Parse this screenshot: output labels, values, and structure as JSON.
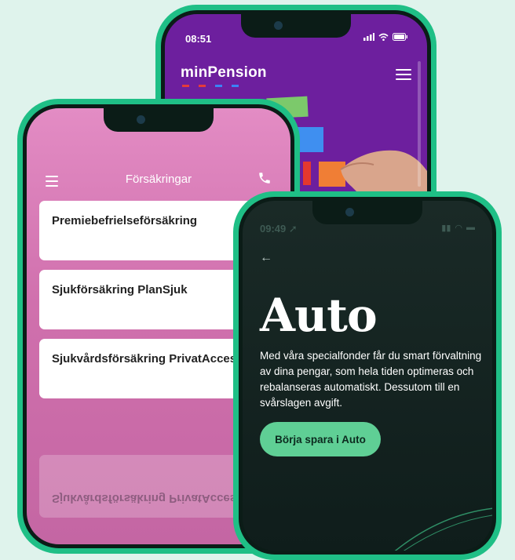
{
  "phone_minpension": {
    "time": "08:51",
    "logo": "minPension",
    "logo_dot_colors": [
      "#e53b3b",
      "#e53b3b",
      "#3b82f6",
      "#3b82f6"
    ],
    "background": "#6d1f9e",
    "menu_icon": "hamburger-menu-icon"
  },
  "phone_insurance": {
    "title": "Försäkringar",
    "menu_icon": "hamburger-menu-icon",
    "call_icon": "phone-icon",
    "cards": [
      {
        "label": "Premiebefrielseförsäkring"
      },
      {
        "label": "Sjukförsäkring PlanSjuk"
      },
      {
        "label": "Sjukvårdsförsäkring PrivatAccess silver"
      }
    ],
    "background": "#d070ad"
  },
  "phone_auto": {
    "time": "09:49",
    "back_icon": "back-arrow-icon",
    "title": "Auto",
    "description": "Med våra specialfonder får du smart förvaltning av dina pengar, som hela tiden optimeras och rebalanseras automatiskt. Dessutom till en svårslagen avgift.",
    "cta_label": "Börja spara i Auto",
    "accent": "#5fcf95"
  }
}
